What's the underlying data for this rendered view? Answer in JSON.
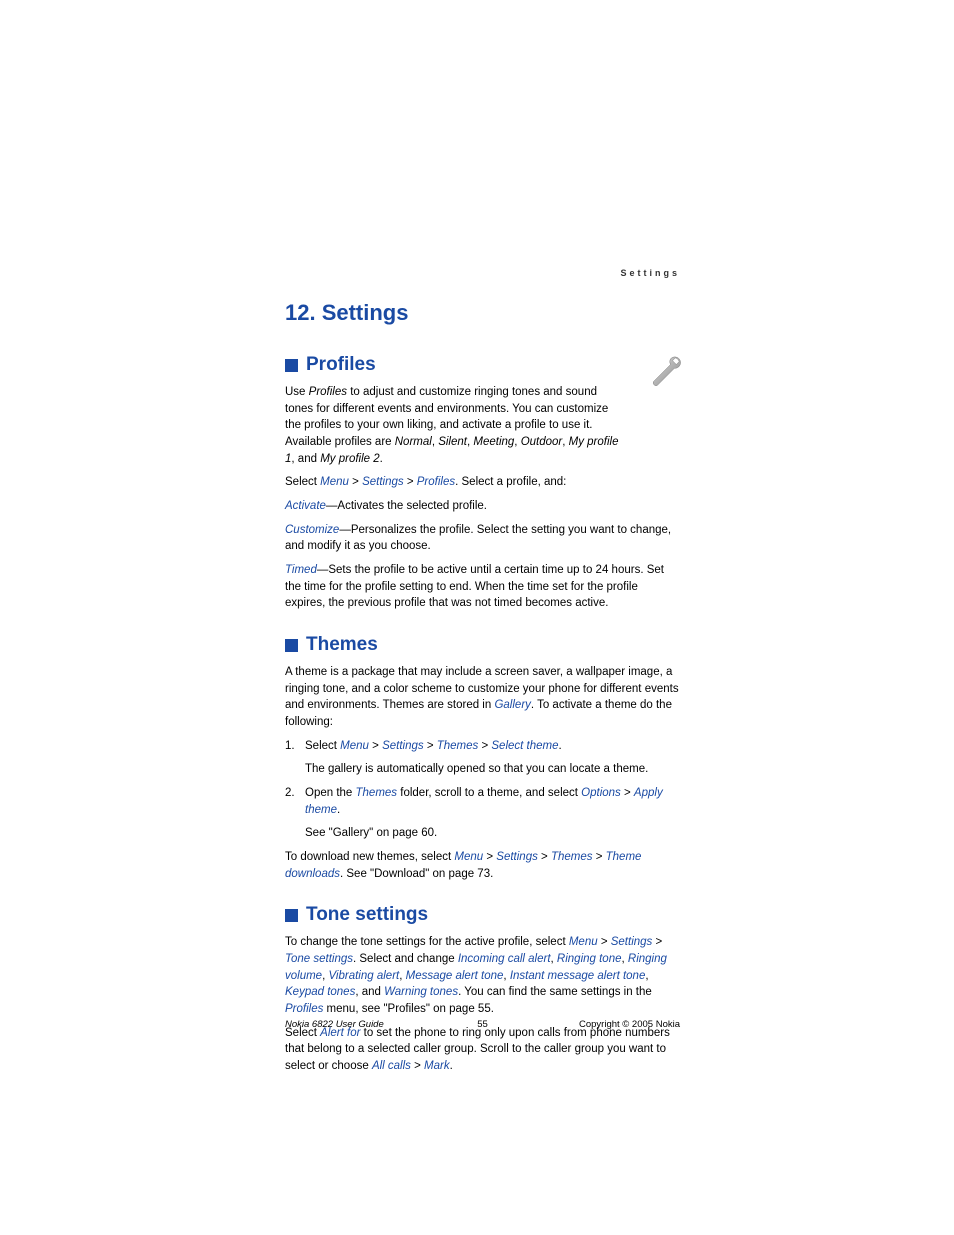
{
  "header": {
    "running": "Settings"
  },
  "chapter": {
    "title": "12. Settings"
  },
  "profiles": {
    "heading": "Profiles",
    "p1_a": "Use ",
    "p1_b": "Profiles",
    "p1_c": " to adjust and customize ringing tones and sound tones for different events and environments. You can customize the profiles to your own liking, and activate a profile to use it. Available profiles are ",
    "p1_d": "Normal",
    "p1_e": "Silent",
    "p1_f": "Meeting",
    "p1_g": "Outdoor",
    "p1_h": "My profile 1",
    "p1_i": "My profile 2",
    "p2_a": "Select ",
    "p2_menu": "Menu",
    "p2_settings": "Settings",
    "p2_profiles": "Profiles",
    "p2_b": ". Select a profile, and:",
    "p3_link": "Activate",
    "p3_txt": "—Activates the selected profile.",
    "p4_link": "Customize",
    "p4_txt": "—Personalizes the profile. Select the setting you want to change, and modify it as you choose.",
    "p5_link": "Timed",
    "p5_txt": "—Sets the profile to be active until a certain time up to 24 hours. Set the time for the profile setting to end. When the time set for the profile expires, the previous profile that was not timed becomes active."
  },
  "themes": {
    "heading": "Themes",
    "p1_a": "A theme is a package that may include a screen saver, a wallpaper image, a ringing tone, and a color scheme to customize your phone for different events and environments. Themes are stored in ",
    "p1_gallery": "Gallery",
    "p1_b": ". To activate a theme do the following:",
    "li1_a": "Select ",
    "li1_menu": "Menu",
    "li1_settings": "Settings",
    "li1_themes": "Themes",
    "li1_select": "Select theme",
    "li1_sub": "The gallery is automatically opened so that you can locate a theme.",
    "li2_a": "Open the ",
    "li2_themes": "Themes",
    "li2_b": " folder, scroll to a theme, and select ",
    "li2_options": "Options",
    "li2_apply": "Apply theme",
    "li2_sub": "See \"Gallery\" on page 60.",
    "p2_a": "To download new themes, select ",
    "p2_menu": "Menu",
    "p2_settings": "Settings",
    "p2_themes": "Themes",
    "p2_dl": "Theme downloads",
    "p2_b": ". See \"Download\" on page 73."
  },
  "tones": {
    "heading": "Tone settings",
    "p1_a": "To change the tone settings for the active profile, select ",
    "p1_menu": "Menu",
    "p1_settings": "Settings",
    "p1_tone": "Tone settings",
    "p1_b": ". Select and change ",
    "p1_l1": "Incoming call alert",
    "p1_l2": "Ringing tone",
    "p1_l3": "Ringing volume",
    "p1_l4": "Vibrating alert",
    "p1_l5": "Message alert tone",
    "p1_l6": "Instant message alert tone",
    "p1_l7": "Keypad tones",
    "p1_and": ", and ",
    "p1_l8": "Warning tones",
    "p1_c": ". You can find the same settings in the ",
    "p1_profiles": "Profiles",
    "p1_d": " menu, see \"Profiles\" on page 55.",
    "p2_a": "Select ",
    "p2_alert": "Alert for",
    "p2_b": " to set the phone to ring only upon calls from phone numbers that belong to a selected caller group. Scroll to the caller group you want to select or choose ",
    "p2_all": "All calls",
    "p2_mark": "Mark"
  },
  "footer": {
    "left": "Nokia 6822 User Guide",
    "center": "55",
    "right": "Copyright © 2005 Nokia"
  }
}
